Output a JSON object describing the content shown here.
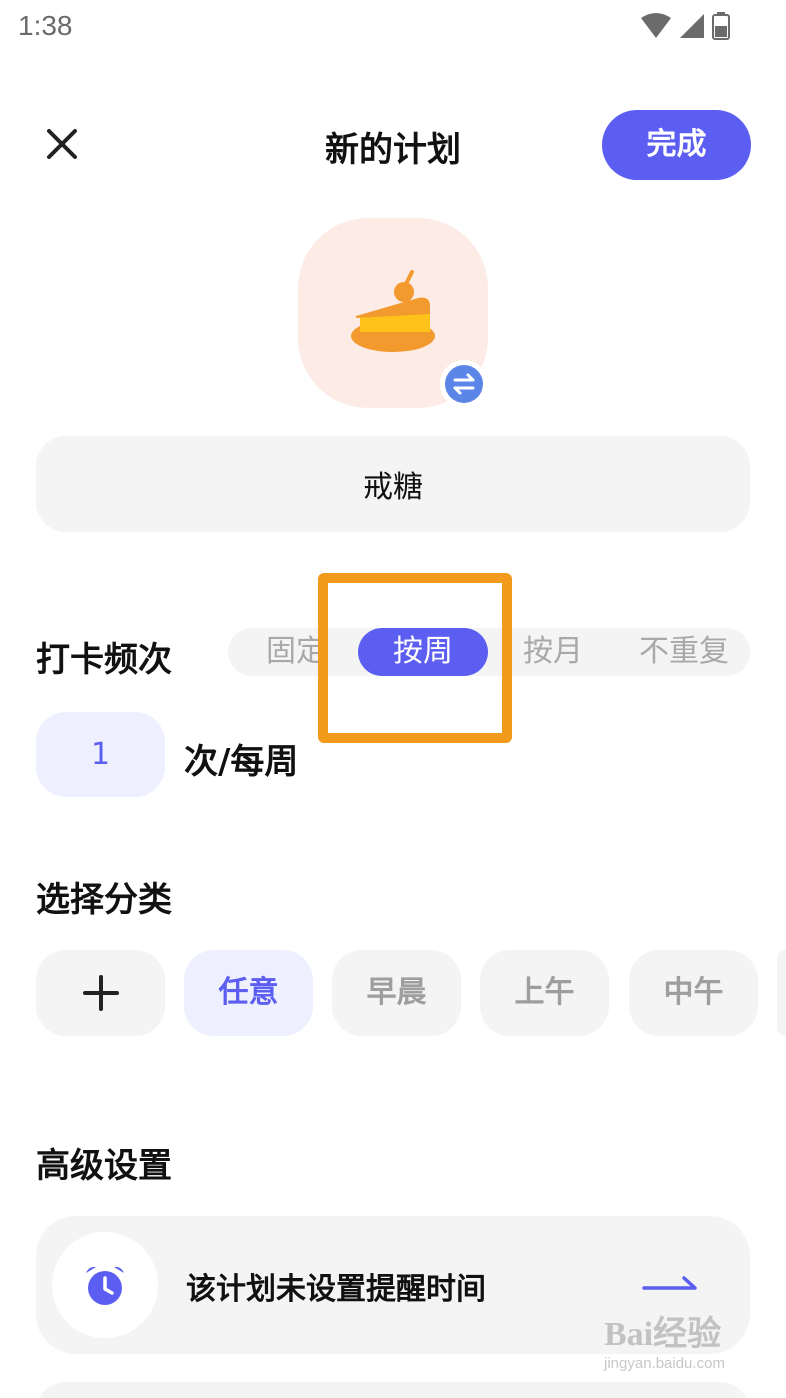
{
  "status_bar": {
    "time": "1:38"
  },
  "header": {
    "title": "新的计划",
    "done_label": "完成"
  },
  "plan": {
    "name": "戒糖",
    "icon": "cake-icon"
  },
  "frequency": {
    "label": "打卡频次",
    "options": [
      "固定",
      "按周",
      "按月",
      "不重复"
    ],
    "selected": "按周",
    "count": "1",
    "unit": "次/每周"
  },
  "category": {
    "label": "选择分类",
    "add_icon": "plus-icon",
    "chips": [
      "任意",
      "早晨",
      "上午",
      "中午"
    ],
    "selected": "任意"
  },
  "advanced": {
    "label": "高级设置",
    "reminder_text": "该计划未设置提醒时间",
    "reminder_icon": "alarm-clock-icon"
  },
  "watermark": {
    "logo": "Bai经验",
    "url": "jingyan.baidu.com"
  },
  "colors": {
    "accent": "#5b5ef0",
    "highlight": "#f19a1c",
    "icon_bg": "#fdebe6"
  }
}
